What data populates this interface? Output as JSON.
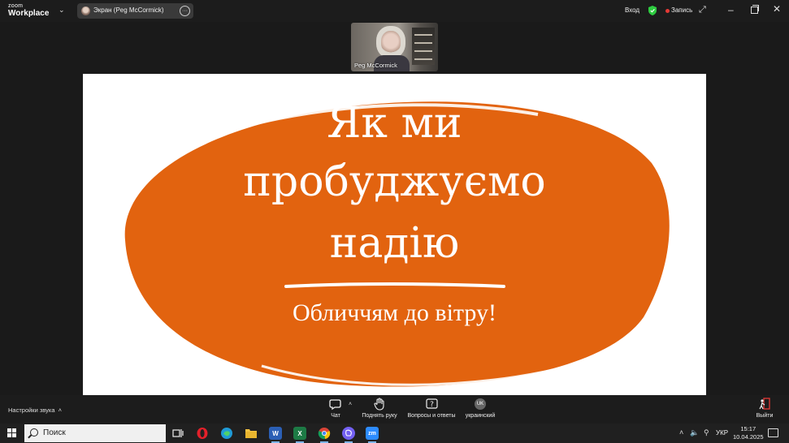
{
  "app": {
    "logo_line1": "zoom",
    "logo_line2": "Workplace",
    "share_label": "Экран (Peg McCormick)",
    "signin_label": "Вход",
    "record_label": "Запись"
  },
  "participant": {
    "name": "Peg McCormick"
  },
  "slide": {
    "line1": "Як ми",
    "line2": "пробуджуємо",
    "line3": "надію",
    "subtitle": "Обличчям до вітру!",
    "blob_color": "#e2630f"
  },
  "toolbar": {
    "audio_settings": "Настройки звука",
    "chat": "Чат",
    "raise_hand": "Поднять руку",
    "qa": "Вопросы и ответы",
    "language_badge": "UK",
    "language": "украинский",
    "leave": "Выйти"
  },
  "taskbar": {
    "search_placeholder": "Поиск",
    "apps": [
      "task-view",
      "opera",
      "edge",
      "file-explorer",
      "word",
      "excel",
      "chrome",
      "viber",
      "zoom"
    ],
    "input_language": "УКР",
    "time": "15:17",
    "date": "10.04.2025"
  },
  "colors": {
    "accent": "#e2630f",
    "record": "#e53935",
    "shield": "#2ecc40"
  }
}
